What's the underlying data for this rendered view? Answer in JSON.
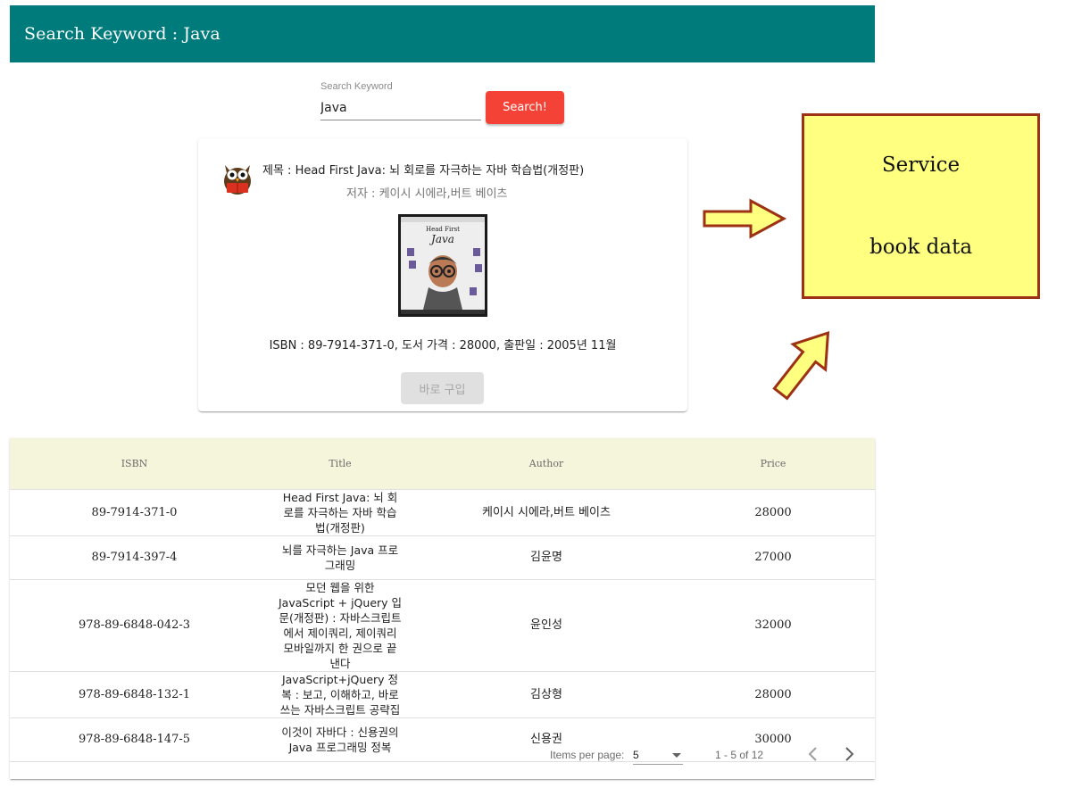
{
  "header": {
    "title": "Search Keyword : Java"
  },
  "search": {
    "label": "Search Keyword",
    "value": "Java",
    "button_label": "Search!"
  },
  "card": {
    "title": "제목 : Head First Java: 뇌 회로를 자극하는 자바 학습법(개정판)",
    "subtitle": "저자 : 케이시 시에라,버트 베이츠",
    "cover": {
      "line1": "Head First",
      "line2": "Java"
    },
    "content": "ISBN : 89-7914-371-0, 도서 가격 : 28000, 출판일 : 2005년 11월",
    "buy_label": "바로 구입"
  },
  "service_box": {
    "line1": "Service",
    "line2": "book data"
  },
  "table": {
    "headers": {
      "isbn": "ISBN",
      "title": "Title",
      "author": "Author",
      "price": "Price"
    },
    "rows": [
      {
        "isbn": "89-7914-371-0",
        "title": "Head First Java: 뇌 회로를 자극하는 자바 학습법(개정판)",
        "author": "케이시 시에라,버트 베이츠",
        "price": "28000"
      },
      {
        "isbn": "89-7914-397-4",
        "title": "뇌를 자극하는 Java 프로그래밍",
        "author": "김윤명",
        "price": "27000"
      },
      {
        "isbn": "978-89-6848-042-3",
        "title": "모던 웹을 위한 JavaScript + jQuery 입문(개정판) : 자바스크립트에서 제이쿼리, 제이쿼리 모바일까지 한 권으로 끝낸다",
        "author": "윤인성",
        "price": "32000"
      },
      {
        "isbn": "978-89-6848-132-1",
        "title": "JavaScript+jQuery 정복 : 보고, 이해하고, 바로 쓰는 자바스크립트 공략집",
        "author": "김상형",
        "price": "28000"
      },
      {
        "isbn": "978-89-6848-147-5",
        "title": "이것이 자바다 : 신용권의 Java 프로그래밍 정복",
        "author": "신용권",
        "price": "30000"
      }
    ]
  },
  "paginator": {
    "items_per_page_label": "Items per page:",
    "page_size": "5",
    "range_label": "1 - 5 of 12"
  },
  "colors": {
    "toolbar": "#007b7b",
    "search_button": "#f44336",
    "service_fill": "#ffff80",
    "service_border": "#9c3213",
    "table_header": "#f5f5dc"
  }
}
